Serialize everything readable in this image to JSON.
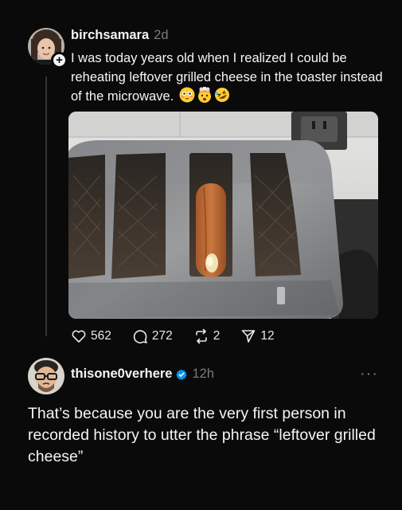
{
  "post": {
    "username": "birchsamara",
    "time": "2d",
    "text": "I was today years old when I realized I could be reheating leftover grilled cheese in the toaster instead of the microwave.",
    "emojis": [
      "flushed-face",
      "exploding-head",
      "rolling-laughing-face"
    ],
    "follow_badge": "+"
  },
  "actions": {
    "likes": "562",
    "comments": "272",
    "reposts": "2",
    "shares": "12"
  },
  "reply": {
    "username": "thisone0verhere",
    "time": "12h",
    "more": "···",
    "text": "That’s because you are the very first person in recorded history to utter the phrase “leftover grilled cheese”"
  },
  "colors": {
    "background": "#0a0a0a",
    "text": "#f3f5f7",
    "muted": "#777b7f",
    "verified": "#0095f6"
  }
}
